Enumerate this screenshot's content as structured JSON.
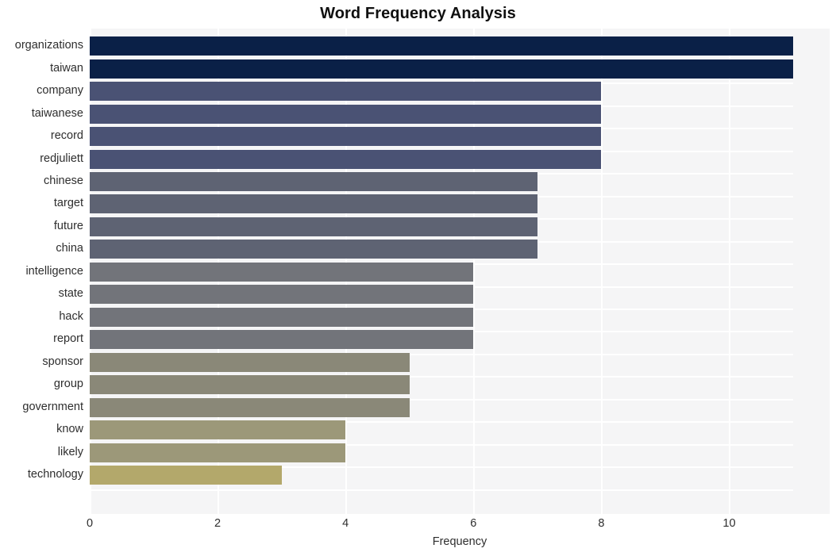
{
  "chart_data": {
    "type": "bar",
    "orientation": "horizontal",
    "title": "Word Frequency Analysis",
    "xlabel": "Frequency",
    "ylabel": "",
    "xlim": [
      0,
      11
    ],
    "xticks": [
      0,
      2,
      4,
      6,
      8,
      10
    ],
    "xtick_labels": [
      "0",
      "2",
      "4",
      "6",
      "8",
      "10"
    ],
    "grid": true,
    "legend": "none",
    "categories": [
      "organizations",
      "taiwan",
      "company",
      "taiwanese",
      "record",
      "redjuliett",
      "chinese",
      "target",
      "future",
      "china",
      "intelligence",
      "state",
      "hack",
      "report",
      "sponsor",
      "group",
      "government",
      "know",
      "likely",
      "technology"
    ],
    "values": [
      11,
      11,
      8,
      8,
      8,
      8,
      7,
      7,
      7,
      7,
      6,
      6,
      6,
      6,
      5,
      5,
      5,
      4,
      4,
      3
    ],
    "bar_colors": [
      "#0a2047",
      "#0a2047",
      "#4a5274",
      "#4a5274",
      "#4a5274",
      "#4a5274",
      "#5e6373",
      "#5e6373",
      "#5e6373",
      "#5e6373",
      "#72747a",
      "#72747a",
      "#72747a",
      "#72747a",
      "#8a8878",
      "#8a8878",
      "#8a8878",
      "#9c9879",
      "#9c9879",
      "#b3a86b"
    ]
  },
  "style": {
    "plot_background": "#f5f5f6",
    "page_background": "#ffffff",
    "gridline_color": "#ffffff",
    "title_color": "#101010",
    "tick_color": "#2e2e2e"
  }
}
